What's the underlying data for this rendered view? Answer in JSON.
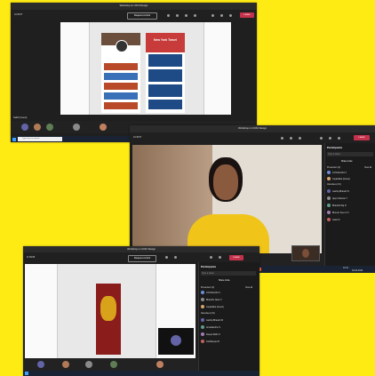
{
  "window_title": "Workshop on UX/UI Design",
  "timer_top": "10:36:57",
  "timer_bottom": "11:59:58",
  "request_control": "Request control",
  "leave": "Leave",
  "presenter_label": "Sakthi (Guest)",
  "speaker_label": "Jayasalika Vinod",
  "search_placeholder": "Type here to search",
  "phone_headline": "New York Travel",
  "participants": {
    "title": "Participants",
    "search": "Type a name",
    "share_invite": "Share invite",
    "presenters_group": "Presenters (2)",
    "view_all": "View all",
    "attendees_group": "Attendees (31)",
    "people_mid": [
      "JAYASALIKA V",
      "Jayasalika (Guest)",
      "Aashiq Bharath N",
      "Ajay Krishnan T",
      "Bharathi Raj R",
      "Bhuvan Sree S S",
      "Gokul K"
    ],
    "people_bottom": [
      "JAYASALIKA V",
      "Bharathi Jaani V",
      "Jayasalika (Guest)",
      "Aashiq Bharath M",
      "Annalakshmi S",
      "Deepa Rathi U",
      "Karthikeyan B"
    ]
  },
  "clock": {
    "time": "10:41",
    "date": "18-02-2022"
  },
  "colors": {
    "background": "#FFEB14",
    "teams_dark": "#1f1f1f",
    "leave_red": "#c4314b",
    "accent_purple": "#6264a7"
  }
}
